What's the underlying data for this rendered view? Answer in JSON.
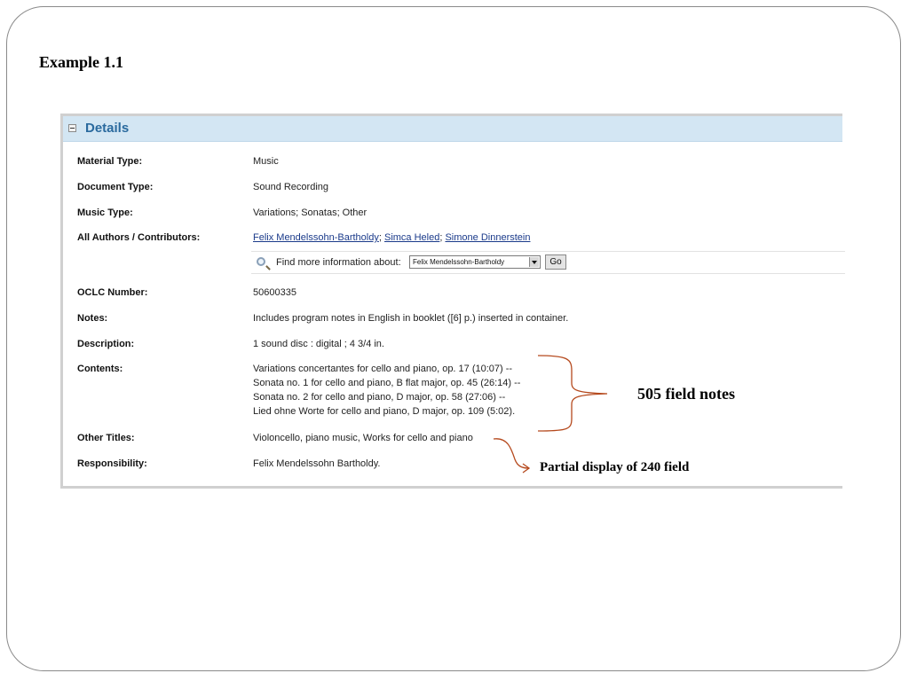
{
  "slide": {
    "title": "Example 1.1"
  },
  "panel": {
    "title": "Details",
    "fields": {
      "material_type": {
        "label": "Material Type:",
        "value": "Music"
      },
      "document_type": {
        "label": "Document Type:",
        "value": "Sound Recording"
      },
      "music_type": {
        "label": "Music Type:",
        "value": "Variations; Sonatas; Other"
      },
      "authors": {
        "label": "All Authors / Contributors:",
        "links": [
          "Felix Mendelssohn-Bartholdy",
          "Simca Heled",
          "Simone Dinnerstein"
        ],
        "separator": ";"
      },
      "find_more": {
        "label": "Find more information about:",
        "selected": "Felix Mendelssohn-Bartholdy",
        "go_label": "Go"
      },
      "oclc": {
        "label": "OCLC Number:",
        "value": "50600335"
      },
      "notes": {
        "label": "Notes:",
        "value": "Includes program notes in English in booklet ([6] p.) inserted in container."
      },
      "description": {
        "label": "Description:",
        "value": "1 sound disc : digital ; 4 3/4 in."
      },
      "contents": {
        "label": "Contents:",
        "lines": [
          "Variations concertantes for cello and piano, op. 17 (10:07) --",
          "Sonata no. 1 for cello and piano, B flat major, op. 45 (26:14) --",
          "Sonata no. 2 for cello and piano, D major, op. 58 (27:06) --",
          "Lied ohne Worte for cello and piano, D major, op. 109 (5:02)."
        ]
      },
      "other_titles": {
        "label": "Other Titles:",
        "value": "Violoncello, piano music, Works for cello and piano"
      },
      "responsibility": {
        "label": "Responsibility:",
        "value": "Felix Mendelssohn Bartholdy."
      }
    }
  },
  "annotations": {
    "field_505": "505 field notes",
    "field_240": "Partial display of 240 field",
    "color": "#b5491d"
  }
}
